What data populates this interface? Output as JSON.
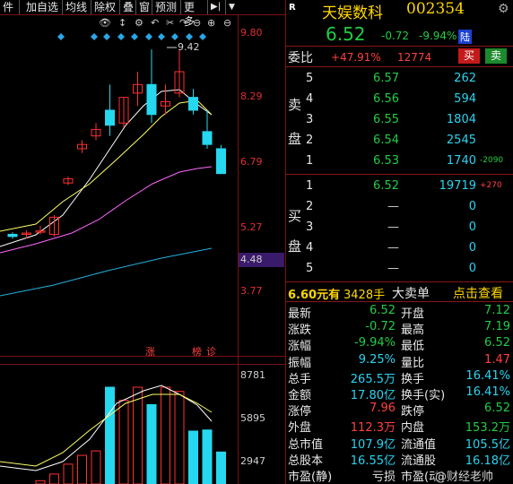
{
  "toolbar": {
    "items": [
      "件",
      "加自选",
      "均线",
      "除权",
      "叠",
      "窗",
      "预测",
      "更多"
    ],
    "arrow": "▶|",
    "dropdown": "▼"
  },
  "chart_data": {
    "type": "candlestick",
    "price_axis_ticks": [
      "9.80",
      "8.29",
      "6.79",
      "5.27",
      "4.48",
      "3.77"
    ],
    "current_price_label": "4.48",
    "peak_label": "9.42",
    "badges": [
      "涨",
      "榜",
      "诊"
    ],
    "volume_axis_ticks": [
      "8781",
      "5895",
      "2947"
    ],
    "candles": [
      {
        "o": 5.1,
        "c": 5.05,
        "h": 5.15,
        "l": 5.0
      },
      {
        "o": 5.1,
        "c": 5.13,
        "h": 5.2,
        "l": 5.0
      },
      {
        "o": 5.15,
        "c": 5.18,
        "h": 5.3,
        "l": 5.1
      },
      {
        "o": 5.1,
        "c": 5.5,
        "h": 5.55,
        "l": 5.05
      },
      {
        "o": 6.3,
        "c": 6.4,
        "h": 6.45,
        "l": 6.25
      },
      {
        "o": 7.1,
        "c": 7.2,
        "h": 7.3,
        "l": 7.0
      },
      {
        "o": 7.4,
        "c": 7.55,
        "h": 7.7,
        "l": 7.3
      },
      {
        "o": 8.0,
        "c": 7.65,
        "h": 8.6,
        "l": 7.4
      },
      {
        "o": 7.7,
        "c": 8.3,
        "h": 8.3,
        "l": 7.6
      },
      {
        "o": 8.4,
        "c": 8.6,
        "h": 8.9,
        "l": 8.1
      },
      {
        "o": 8.6,
        "c": 7.9,
        "h": 9.42,
        "l": 7.7
      },
      {
        "o": 8.1,
        "c": 8.2,
        "h": 8.6,
        "l": 7.9
      },
      {
        "o": 8.4,
        "c": 8.9,
        "h": 9.42,
        "l": 8.3
      },
      {
        "o": 8.3,
        "c": 8.0,
        "h": 8.5,
        "l": 7.9
      },
      {
        "o": 7.5,
        "c": 7.2,
        "h": 8.0,
        "l": 7.1
      },
      {
        "o": 7.1,
        "c": 6.52,
        "h": 7.19,
        "l": 6.52
      }
    ],
    "volume": [
      0,
      0,
      300,
      900,
      1800,
      2600,
      3000,
      8781,
      7600,
      8781,
      7200,
      8781,
      8400,
      4800,
      4900,
      2900
    ]
  },
  "header": {
    "badge": "R",
    "name": "天娱数科",
    "code": "002354",
    "price": "6.52",
    "change": "-0.72",
    "change_pct": "-9.94%",
    "exchange_badge": "陆"
  },
  "weibi": {
    "label": "委比",
    "pct": "+47.91%",
    "value": "12774",
    "buy_btn": "买",
    "sell_btn": "卖"
  },
  "sell_side_label": [
    "卖",
    "盘"
  ],
  "buy_side_label": [
    "买",
    "盘"
  ],
  "sell_orders": [
    {
      "lvl": "5",
      "price": "6.57",
      "vol": "262",
      "delta": ""
    },
    {
      "lvl": "4",
      "price": "6.56",
      "vol": "594",
      "delta": ""
    },
    {
      "lvl": "3",
      "price": "6.55",
      "vol": "1804",
      "delta": ""
    },
    {
      "lvl": "2",
      "price": "6.54",
      "vol": "2545",
      "delta": ""
    },
    {
      "lvl": "1",
      "price": "6.53",
      "vol": "1740",
      "delta": "-2090"
    }
  ],
  "buy_orders": [
    {
      "lvl": "1",
      "price": "6.52",
      "vol": "19719",
      "delta": "+270"
    },
    {
      "lvl": "2",
      "price": "—",
      "vol": "0",
      "delta": ""
    },
    {
      "lvl": "3",
      "price": "—",
      "vol": "0",
      "delta": ""
    },
    {
      "lvl": "4",
      "price": "—",
      "vol": "0",
      "delta": ""
    },
    {
      "lvl": "5",
      "price": "—",
      "vol": "0",
      "delta": ""
    }
  ],
  "big_order": {
    "price": "6.60元有",
    "hands": "3428手",
    "label": "大卖单",
    "link": "点击查看"
  },
  "stats": [
    {
      "l1": "最新",
      "v1": "6.52",
      "c1": "green",
      "l2": "开盘",
      "v2": "7.12",
      "c2": "green"
    },
    {
      "l1": "涨跌",
      "v1": "-0.72",
      "c1": "green",
      "l2": "最高",
      "v2": "7.19",
      "c2": "green"
    },
    {
      "l1": "涨幅",
      "v1": "-9.94%",
      "c1": "green",
      "l2": "最低",
      "v2": "6.52",
      "c2": "green"
    },
    {
      "l1": "振幅",
      "v1": "9.25%",
      "c1": "cyan",
      "l2": "量比",
      "v2": "1.47",
      "c2": "red"
    },
    {
      "l1": "总手",
      "v1": "265.5万",
      "c1": "cyan",
      "l2": "换手",
      "v2": "16.41%",
      "c2": "cyan"
    },
    {
      "l1": "金额",
      "v1": "17.80亿",
      "c1": "cyan",
      "l2": "换手(实)",
      "v2": "16.41%",
      "c2": "cyan"
    },
    {
      "l1": "涨停",
      "v1": "7.96",
      "c1": "red",
      "l2": "跌停",
      "v2": "6.52",
      "c2": "green"
    },
    {
      "l1": "外盘",
      "v1": "112.3万",
      "c1": "red",
      "l2": "内盘",
      "v2": "153.2万",
      "c2": "green"
    },
    {
      "l1": "总市值",
      "v1": "107.9亿",
      "c1": "cyan",
      "l2": "流通值",
      "v2": "105.5亿",
      "c2": "cyan"
    },
    {
      "l1": "总股本",
      "v1": "16.55亿",
      "c1": "cyan",
      "l2": "流通股",
      "v2": "16.18亿",
      "c2": "cyan"
    },
    {
      "l1": "市盈(静)",
      "v1": "亏损",
      "c1": "white",
      "l2": "市盈(动)",
      "v2": "",
      "c2": "cyan"
    }
  ],
  "watermark": "@财经老帅",
  "colors": {
    "up": "#ff3030",
    "down": "#26d7f0",
    "ma5": "#ffffff",
    "ma10": "#ffff66",
    "ma20": "#ff66ff",
    "ma60": "#22b0e0",
    "grid": "#7a1010"
  }
}
